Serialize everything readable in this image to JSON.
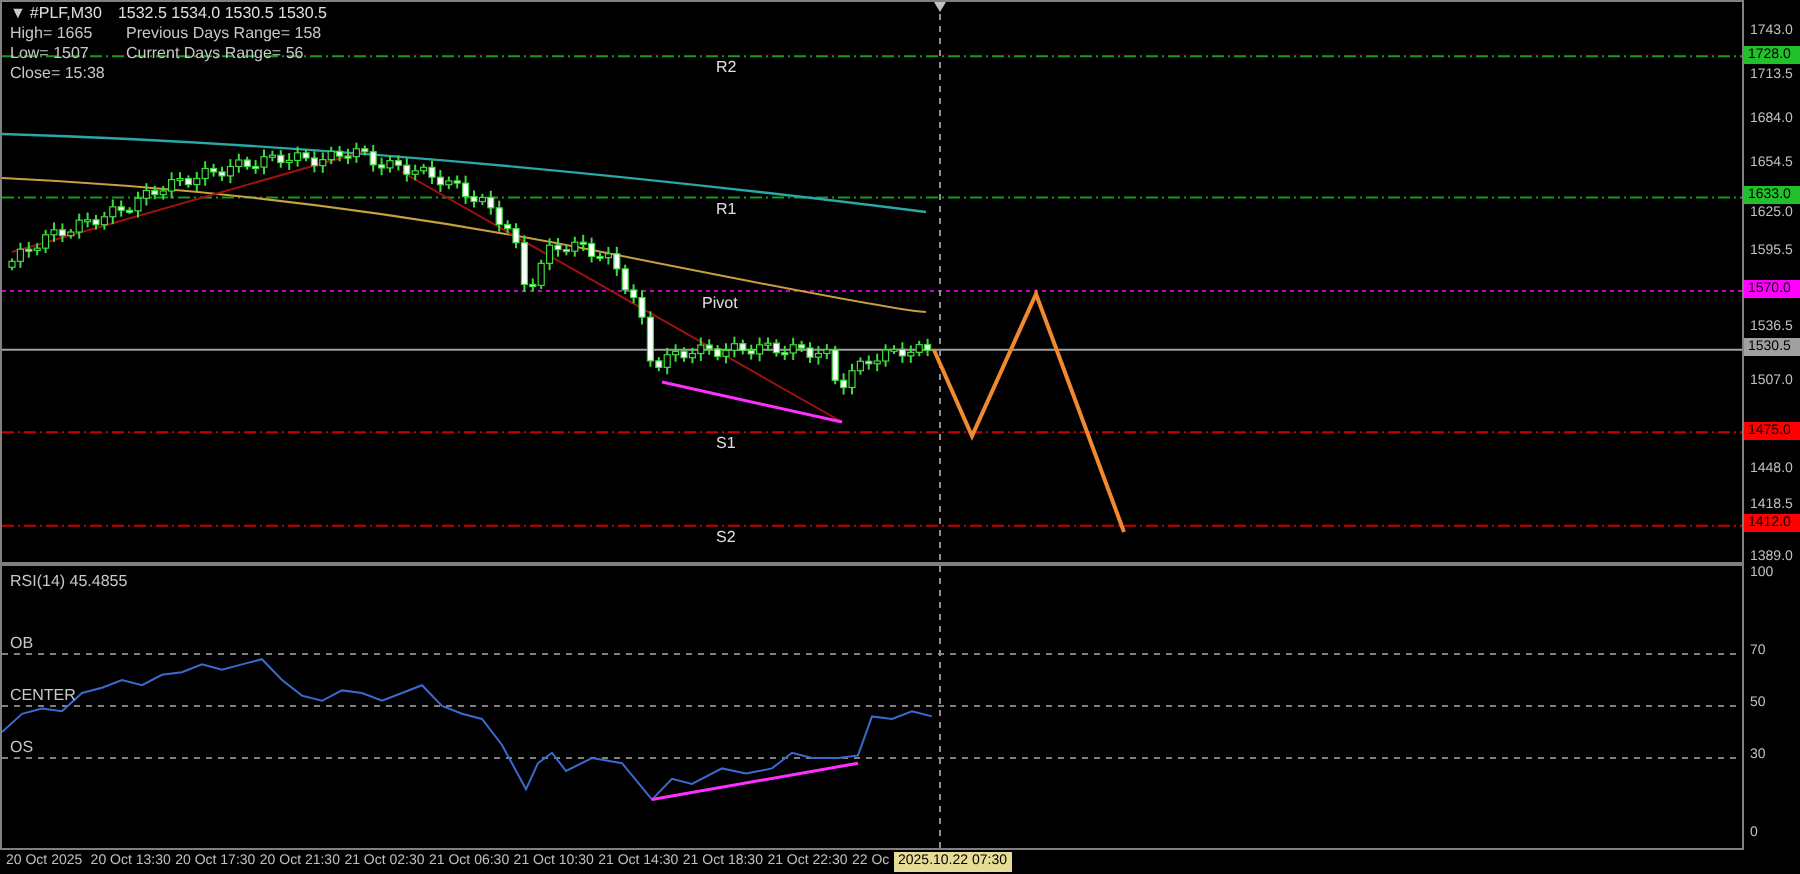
{
  "header": {
    "toggle": "▼",
    "symbol": "#PLF,M30",
    "ohlc": "1532.5 1534.0 1530.5 1530.5"
  },
  "info_rows": [
    {
      "left": "High= 1665",
      "right": "Previous Days Range= 158"
    },
    {
      "left": "Low= 1507",
      "right": "Current Days Range= 56"
    },
    {
      "left": "Close= 15:38"
    }
  ],
  "levels": [
    {
      "kind": "dashdot",
      "label": "R2",
      "price": "1728.0",
      "color": "#22c02a"
    },
    {
      "kind": "dashdot",
      "label": "R1",
      "price": "1633.0",
      "color": "#22c02a"
    },
    {
      "kind": "dotted",
      "label": "Pivot",
      "price": "1570.0",
      "color": "#ff00ff"
    },
    {
      "kind": "solid",
      "price": "1530.5",
      "color": "#a0a0a0"
    },
    {
      "kind": "dashdot",
      "label": "S1",
      "price": "1475.0",
      "color": "#ff0000"
    },
    {
      "kind": "dashdot",
      "label": "S2",
      "price": "1412.0",
      "color": "#ff0000"
    }
  ],
  "price_axis": [
    "1743.0",
    "1713.5",
    "1684.0",
    "1654.5",
    "1625.0",
    "1595.5",
    "1536.5",
    "1507.0",
    "1448.0",
    "1418.5",
    "1389.0"
  ],
  "rsi": {
    "title": "RSI(14) 45.4855",
    "levels": [
      {
        "label": "OB"
      },
      {
        "label": "CENTER"
      },
      {
        "label": "OS"
      }
    ],
    "axis": [
      "100",
      "70",
      "50",
      "30",
      "0"
    ]
  },
  "time_axis": {
    "labels": [
      "20 Oct 2025",
      "20 Oct 13:30",
      "20 Oct 17:30",
      "20 Oct 21:30",
      "21 Oct 02:30",
      "21 Oct 06:30",
      "21 Oct 10:30",
      "21 Oct 14:30",
      "21 Oct 18:30",
      "21 Oct 22:30",
      "22 Oc"
    ],
    "cursor": "2025.10.22 07:30"
  }
}
